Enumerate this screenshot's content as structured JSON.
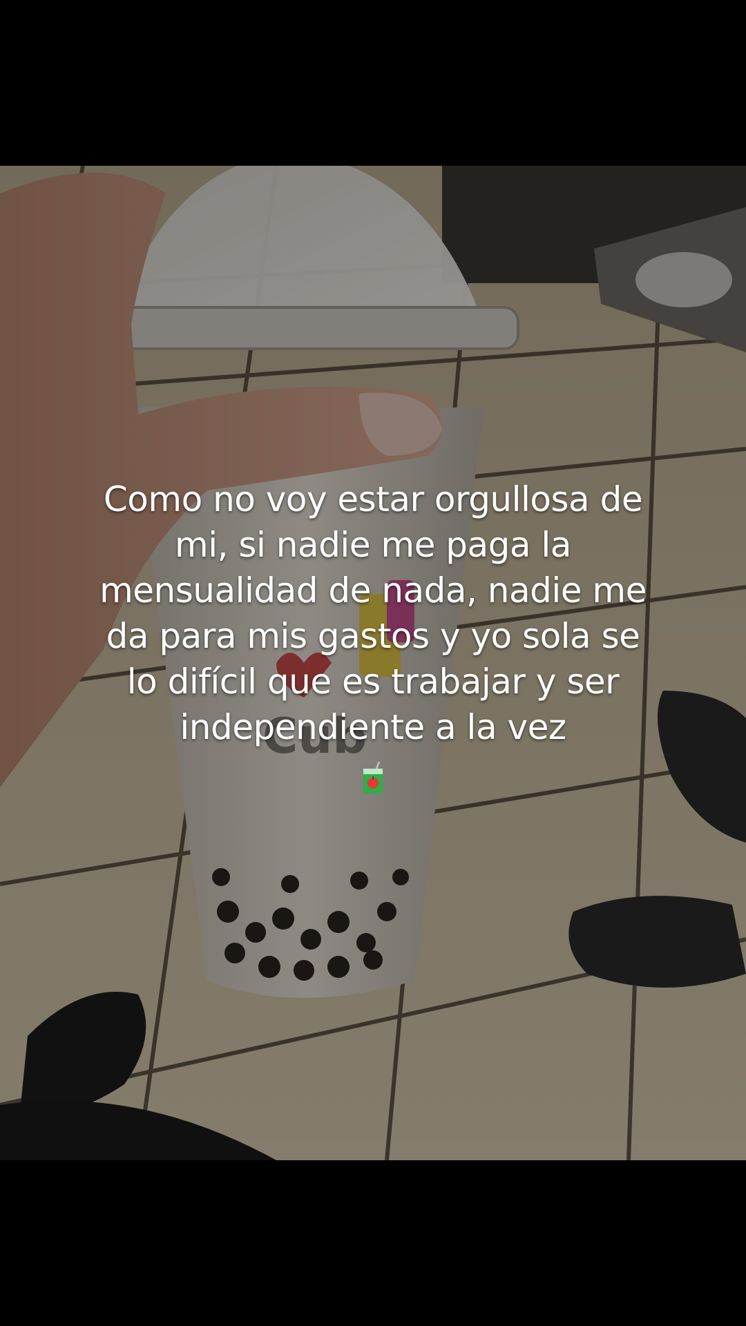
{
  "caption": {
    "text": "Como no voy estar orgullosa de mi, si nadie me paga la mensualidad de nada, nadie me da para mis gastos y yo sola se lo difícil que es trabajar y ser independiente a la vez",
    "emoji": "juice-box-icon"
  },
  "photo": {
    "description_colors": {
      "floor_tile": "#cfc2a8",
      "grout": "#3e3528",
      "cup": "#d9d2c6",
      "skin": "#c99a85",
      "boba": "#2a2420"
    }
  }
}
